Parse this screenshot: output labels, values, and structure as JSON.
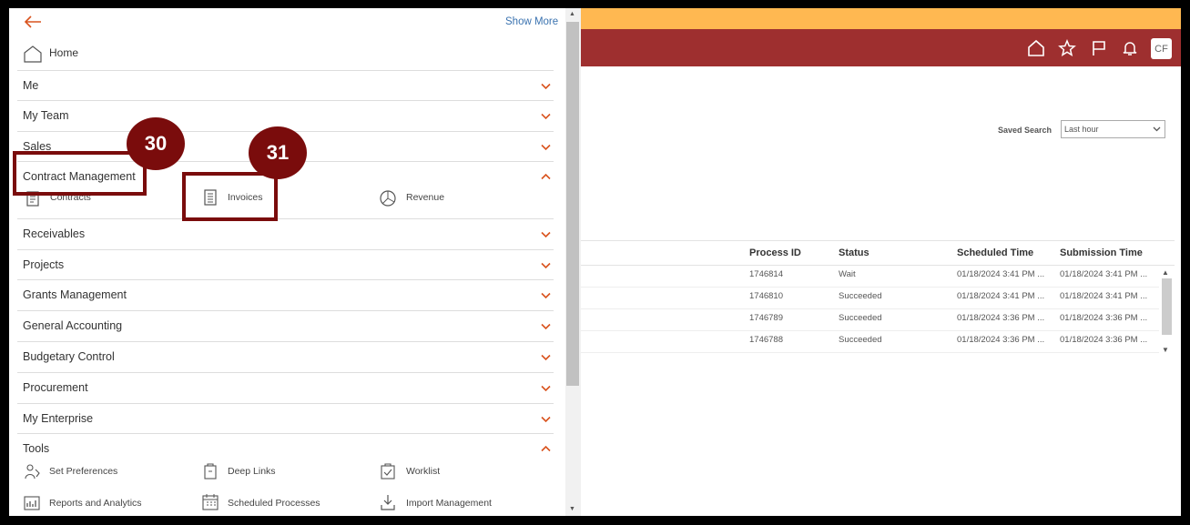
{
  "nav": {
    "show_more": "Show More",
    "home": "Home",
    "sections": [
      "Me",
      "My Team",
      "Sales",
      "Contract Management",
      "Receivables",
      "Projects",
      "Grants Management",
      "General Accounting",
      "Budgetary Control",
      "Procurement",
      "My Enterprise",
      "Tools"
    ],
    "contract_items": [
      "Contracts",
      "Invoices",
      "Revenue"
    ],
    "tools_items": [
      "Set Preferences",
      "Deep Links",
      "Worklist",
      "Reports and Analytics",
      "Scheduled Processes",
      "Import Management"
    ]
  },
  "callouts": [
    "30",
    "31"
  ],
  "header": {
    "avatar": "CF"
  },
  "saved_search": {
    "label": "Saved Search",
    "value": "Last hour"
  },
  "table": {
    "headers": [
      "Process ID",
      "Status",
      "Scheduled Time",
      "Submission Time"
    ],
    "rows": [
      [
        "1746814",
        "Wait",
        "01/18/2024 3:41 PM ...",
        "01/18/2024 3:41 PM ..."
      ],
      [
        "1746810",
        "Succeeded",
        "01/18/2024 3:41 PM ...",
        "01/18/2024 3:41 PM ..."
      ],
      [
        "1746789",
        "Succeeded",
        "01/18/2024 3:36 PM ...",
        "01/18/2024 3:36 PM ..."
      ],
      [
        "1746788",
        "Succeeded",
        "01/18/2024 3:36 PM ...",
        "01/18/2024 3:36 PM ..."
      ]
    ]
  },
  "colors": {
    "accent": "#d9531e",
    "brand_bar": "#9e2f2f",
    "top_strip": "#ffb851",
    "callout": "#7a0c0c",
    "link": "#3b73b0"
  }
}
